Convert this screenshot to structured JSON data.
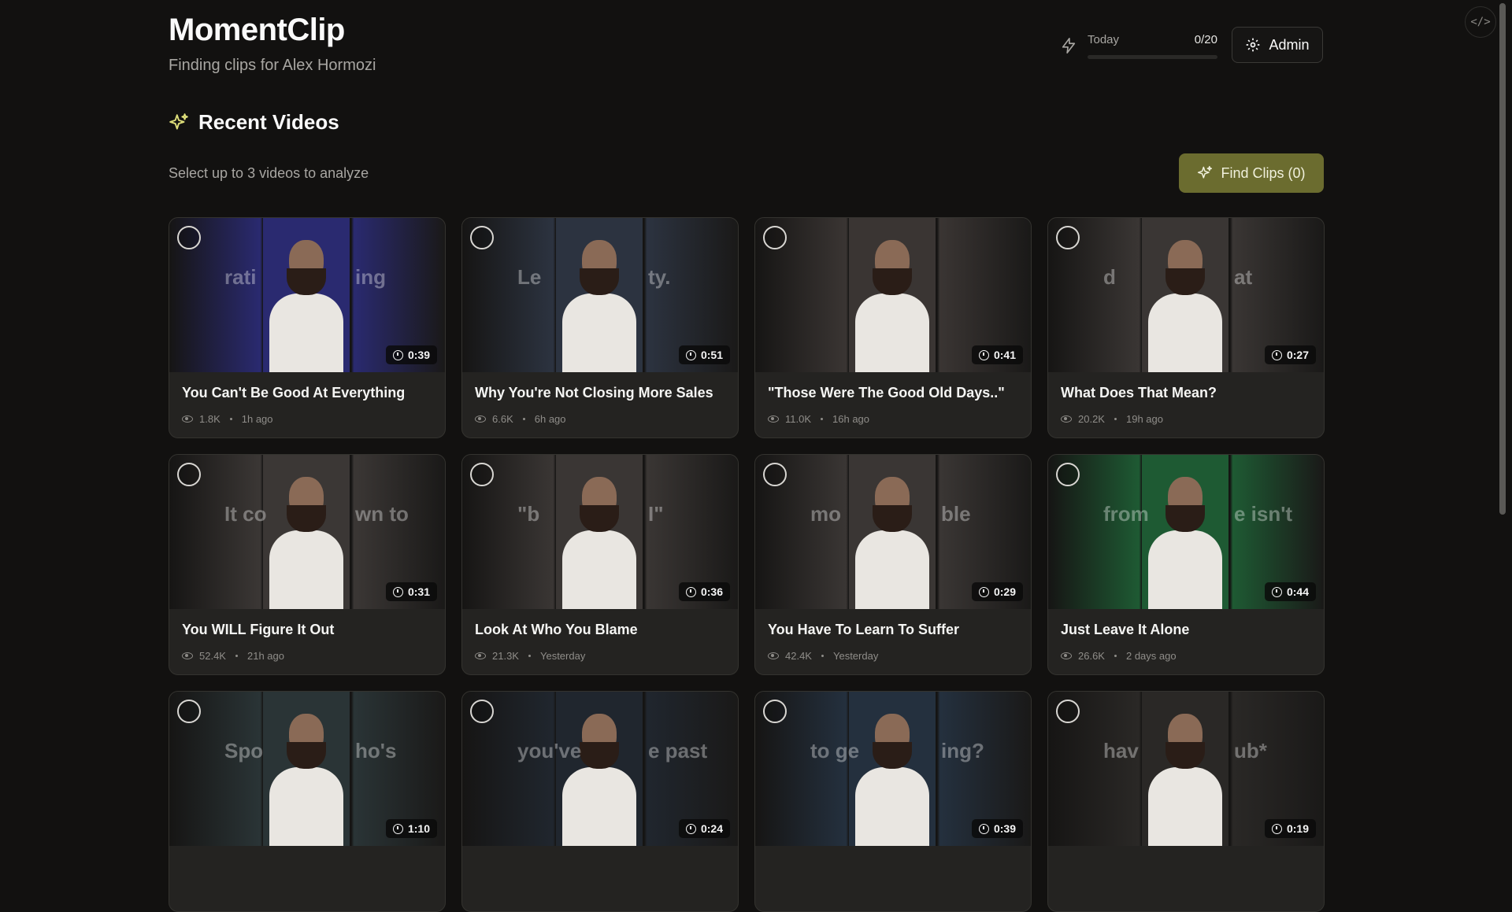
{
  "header": {
    "title": "MomentClip",
    "subtitle": "Finding clips for Alex Hormozi",
    "quota_label": "Today",
    "quota_count": "0/20",
    "quota_fraction": 0.0,
    "admin_label": "Admin"
  },
  "section": {
    "title": "Recent Videos",
    "subtitle": "Select up to 3 videos to analyze",
    "find_button": "Find Clips (0)"
  },
  "colors": {
    "background": "#121110",
    "card": "#242321",
    "accent": "#6b6c2f"
  },
  "videos": [
    {
      "title": "You Can't Be Good At Everything",
      "views": "1.8K",
      "age": "1h ago",
      "duration": "0:39",
      "overlay_left": "rati",
      "overlay_right": "ing",
      "tone": "#2a2a70"
    },
    {
      "title": "Why You're Not Closing More Sales",
      "views": "6.6K",
      "age": "6h ago",
      "duration": "0:51",
      "overlay_left": "Le",
      "overlay_right": "ty.",
      "tone": "#2c3340"
    },
    {
      "title": "\"Those Were The Good Old Days..\"",
      "views": "11.0K",
      "age": "16h ago",
      "duration": "0:41",
      "overlay_left": "",
      "overlay_right": "",
      "tone": "#3a3533"
    },
    {
      "title": "What Does That Mean?",
      "views": "20.2K",
      "age": "19h ago",
      "duration": "0:27",
      "overlay_left": "d",
      "overlay_right": "at",
      "tone": "#3a3634"
    },
    {
      "title": "You WILL Figure It Out",
      "views": "52.4K",
      "age": "21h ago",
      "duration": "0:31",
      "overlay_left": "It co",
      "overlay_right": "wn to",
      "tone": "#3b3735"
    },
    {
      "title": "Look At Who You Blame",
      "views": "21.3K",
      "age": "Yesterday",
      "duration": "0:36",
      "overlay_left": "\"b",
      "overlay_right": "I\"",
      "tone": "#3a3634"
    },
    {
      "title": "You Have To Learn To Suffer",
      "views": "42.4K",
      "age": "Yesterday",
      "duration": "0:29",
      "overlay_left": "mo",
      "overlay_right": "ble",
      "tone": "#3a3634"
    },
    {
      "title": "Just Leave It Alone",
      "views": "26.6K",
      "age": "2 days ago",
      "duration": "0:44",
      "overlay_left": "from",
      "overlay_right": "e isn't",
      "tone": "#1e5a33"
    },
    {
      "title": "",
      "views": "",
      "age": "",
      "duration": "1:10",
      "overlay_left": "Spo",
      "overlay_right": "ho's",
      "tone": "#2a3436"
    },
    {
      "title": "",
      "views": "",
      "age": "",
      "duration": "0:24",
      "overlay_left": "you've",
      "overlay_right": "e past",
      "tone": "#20262e"
    },
    {
      "title": "",
      "views": "",
      "age": "",
      "duration": "0:39",
      "overlay_left": "to ge",
      "overlay_right": "ing?",
      "tone": "#24303e"
    },
    {
      "title": "",
      "views": "",
      "age": "",
      "duration": "0:19",
      "overlay_left": "hav",
      "overlay_right": "ub*",
      "tone": "#2a2826"
    }
  ]
}
